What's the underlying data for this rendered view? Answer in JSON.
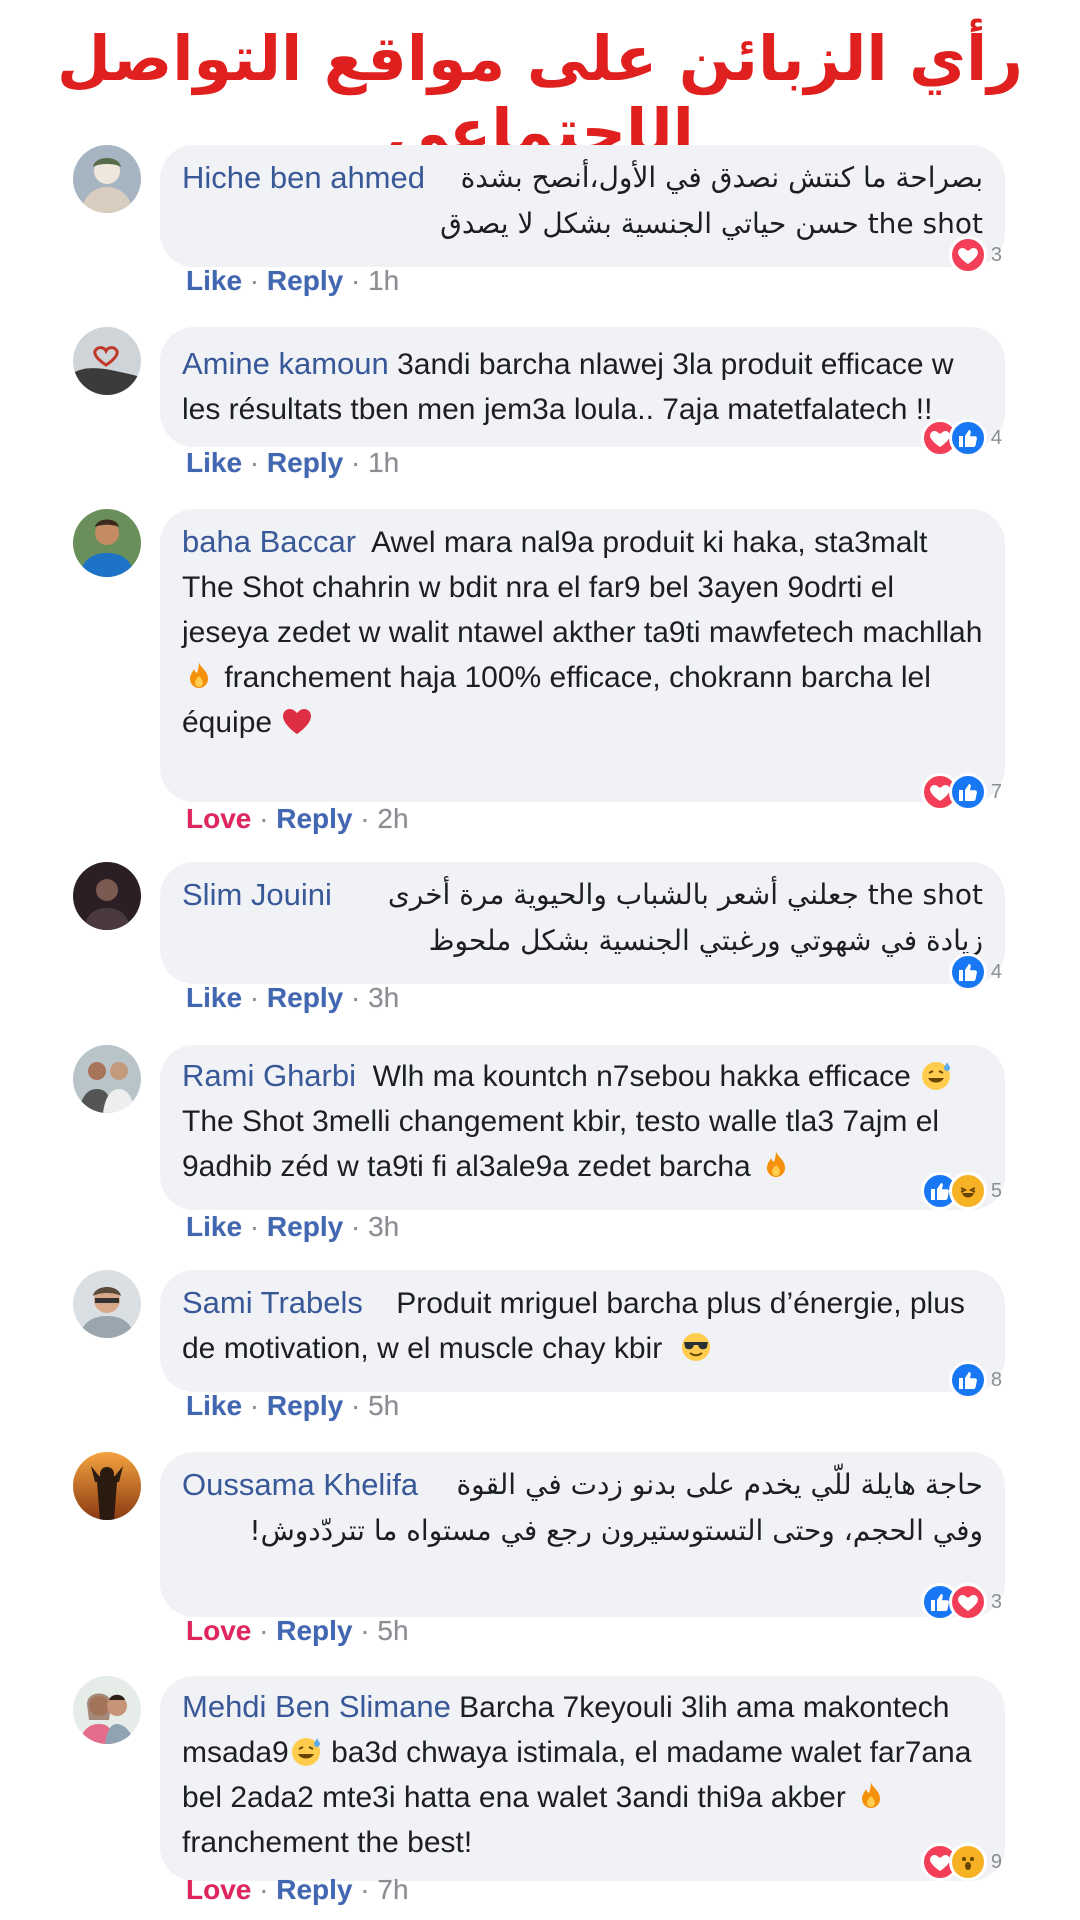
{
  "title": "رأي الزبائن على مواقع التواصل الإجتماعي",
  "colors": {
    "title": "#e0201e",
    "name": "#385898",
    "like": "#4267b2",
    "love": "#e0245e",
    "bubble": "#f0f2f5"
  },
  "comments": [
    {
      "name": "Hiche ben ahmed",
      "text": "بصراحة ما كنتش نصدق في الأول،أنصح بشدة the shot حسن حياتي الجنسية بشكل لا يصدق",
      "action": "Like",
      "reply": "Reply",
      "time": "1h",
      "reactions": [
        "love"
      ],
      "count": "3"
    },
    {
      "name": "Amine kamoun",
      "text": "3andi barcha nlawej 3la produit efficace w les résultats tben men jem3a loula.. 7aja matetfalatech !!",
      "action": "Like",
      "reply": "Reply",
      "time": "1h",
      "reactions": [
        "love",
        "like"
      ],
      "count": "4"
    },
    {
      "name": "baha Baccar",
      "text": "Awel mara nal9a produit ki haka, sta3malt The Shot chahrin w bdit nra el far9 bel 3ayen 9odrti el jeseya zedet w walit ntawel akther ta9ti mawfetech machllah",
      "text_after_emoji1": "franchement haja 100% efficace, chokrann barcha lel équipe",
      "emoji1": "fire-icon",
      "emoji2": "red-heart-icon",
      "action": "Love",
      "reply": "Reply",
      "time": "2h",
      "reactions": [
        "love",
        "like"
      ],
      "count": "7"
    },
    {
      "name": "Slim Jouini",
      "text": "the shot جعلني أشعر بالشباب والحيوية مرة أخرى زيادة في شهوتي ورغبتي الجنسية بشكل ملحوظ",
      "action": "Like",
      "reply": "Reply",
      "time": "3h",
      "reactions": [
        "like"
      ],
      "count": "4"
    },
    {
      "name": "Rami Gharbi",
      "text": "Wlh ma kountch n7sebou hakka efficace",
      "text_after_emoji1": "The Shot 3melli changement kbir,  testo walle tla3 7ajm el 9adhib zéd w ta9ti fi al3ale9a zedet barcha",
      "emoji1": "sweat-smile-icon",
      "emoji2": "fire-icon",
      "action": "Like",
      "reply": "Reply",
      "time": "3h",
      "reactions": [
        "like",
        "haha"
      ],
      "count": "5"
    },
    {
      "name": "Sami Trabels",
      "text": "Produit mriguel barcha plus d’énergie, plus de motivation, w el muscle chay kbir",
      "emoji1": "sunglasses-icon",
      "action": "Like",
      "reply": "Reply",
      "time": "5h",
      "reactions": [
        "like"
      ],
      "count": "8"
    },
    {
      "name": "Oussama Khelifa",
      "text": "حاجة هايلة للّي يخدم على بدنو زدت في القوة وفي الحجم، وحتى التستوستيرون رجع في مستواه ما تتردّدوش!",
      "action": "Love",
      "reply": "Reply",
      "time": "5h",
      "reactions": [
        "like",
        "love"
      ],
      "count": "3"
    },
    {
      "name": "Mehdi Ben Slimane",
      "text": "Barcha 7keyouli 3lih ama makontech msada9",
      "text_after_emoji1": "ba3d chwaya istimala, el madame walet far7ana bel 2ada2 mte3i hatta ena walet 3andi thi9a akber",
      "text_after_emoji2": "franchement the best!",
      "emoji1": "sweat-smile-icon",
      "emoji2": "fire-icon",
      "action": "Love",
      "reply": "Reply",
      "time": "7h",
      "reactions": [
        "love",
        "wow"
      ],
      "count": "9"
    }
  ]
}
